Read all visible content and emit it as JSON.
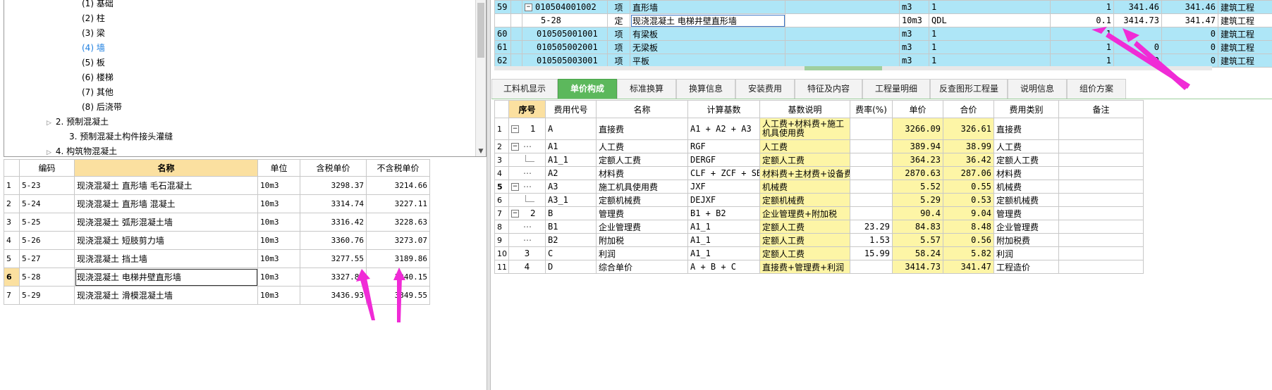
{
  "tree": {
    "items": [
      {
        "label": "(1) 基础",
        "indent": 3
      },
      {
        "label": "(2) 柱",
        "indent": 3
      },
      {
        "label": "(3) 梁",
        "indent": 3
      },
      {
        "label": "(4) 墙",
        "indent": 3,
        "selected": true
      },
      {
        "label": "(5) 板",
        "indent": 3
      },
      {
        "label": "(6) 楼梯",
        "indent": 3
      },
      {
        "label": "(7) 其他",
        "indent": 3
      },
      {
        "label": "(8) 后浇带",
        "indent": 3
      },
      {
        "label": "2. 预制混凝土",
        "indent": 1,
        "arrow": "▷"
      },
      {
        "label": "3. 预制混凝土构件接头灌缝",
        "indent": 2
      },
      {
        "label": "4. 构筑物混凝土",
        "indent": 1,
        "arrow": "▷"
      }
    ]
  },
  "quota_table": {
    "headers": [
      "",
      "编码",
      "名称",
      "单位",
      "含税单价",
      "不含税单价"
    ],
    "rows": [
      {
        "idx": "1",
        "code": "5-23",
        "name": "现浇混凝土 直形墙 毛石混凝土",
        "unit": "10m3",
        "tax_price": "3298.37",
        "notax_price": "3214.66"
      },
      {
        "idx": "2",
        "code": "5-24",
        "name": "现浇混凝土 直形墙 混凝土",
        "unit": "10m3",
        "tax_price": "3314.74",
        "notax_price": "3227.11"
      },
      {
        "idx": "3",
        "code": "5-25",
        "name": "现浇混凝土 弧形混凝土墙",
        "unit": "10m3",
        "tax_price": "3316.42",
        "notax_price": "3228.63"
      },
      {
        "idx": "4",
        "code": "5-26",
        "name": "现浇混凝土 短肢剪力墙",
        "unit": "10m3",
        "tax_price": "3360.76",
        "notax_price": "3273.07"
      },
      {
        "idx": "5",
        "code": "5-27",
        "name": "现浇混凝土 挡土墙",
        "unit": "10m3",
        "tax_price": "3277.55",
        "notax_price": "3189.86"
      },
      {
        "idx": "6",
        "code": "5-28",
        "name": "现浇混凝土 电梯井壁直形墙",
        "unit": "10m3",
        "tax_price": "3327.84",
        "notax_price": "3240.15",
        "current": true
      },
      {
        "idx": "7",
        "code": "5-29",
        "name": "现浇混凝土 滑模混凝土墙",
        "unit": "10m3",
        "tax_price": "3436.93",
        "notax_price": "3349.55"
      }
    ]
  },
  "boq_table": {
    "rows": [
      {
        "seq": "59",
        "code": "010504001002",
        "type": "项",
        "name": "直形墙",
        "unit": "m3",
        "expr": "1",
        "qty": "1",
        "price": "341.46",
        "total": "341.46",
        "category": "建筑工程",
        "box": "−"
      },
      {
        "seq": "",
        "code": "5-28",
        "type": "定",
        "name": "现浇混凝土 电梯井壁直形墙",
        "unit": "10m3",
        "expr": "QDL",
        "qty": "0.1",
        "price": "3414.73",
        "total": "341.47",
        "category": "建筑工程",
        "sub": true
      },
      {
        "seq": "60",
        "code": "010505001001",
        "type": "项",
        "name": "有梁板",
        "unit": "m3",
        "expr": "1",
        "qty": "1",
        "price": "",
        "total": "0",
        "category": "建筑工程"
      },
      {
        "seq": "61",
        "code": "010505002001",
        "type": "项",
        "name": "无梁板",
        "unit": "m3",
        "expr": "1",
        "qty": "1",
        "price": "0",
        "total": "0",
        "category": "建筑工程"
      },
      {
        "seq": "62",
        "code": "010505003001",
        "type": "项",
        "name": "平板",
        "unit": "m3",
        "expr": "1",
        "qty": "1",
        "price": "0",
        "total": "0",
        "category": "建筑工程"
      }
    ]
  },
  "tabs": [
    {
      "label": "工料机显示",
      "active": false
    },
    {
      "label": "单价构成",
      "active": true
    },
    {
      "label": "标准换算",
      "active": false
    },
    {
      "label": "换算信息",
      "active": false
    },
    {
      "label": "安装费用",
      "active": false
    },
    {
      "label": "特征及内容",
      "active": false
    },
    {
      "label": "工程量明细",
      "active": false
    },
    {
      "label": "反查图形工程量",
      "active": false
    },
    {
      "label": "说明信息",
      "active": false
    },
    {
      "label": "组价方案",
      "active": false
    }
  ],
  "price_table": {
    "headers": [
      "序号",
      "费用代号",
      "名称",
      "计算基数",
      "基数说明",
      "费率(%)",
      "单价",
      "合价",
      "费用类别",
      "备注"
    ],
    "rows": [
      {
        "idx": "1",
        "ord": "1",
        "tree": "minus",
        "code": "A",
        "name": "直接费",
        "base": "A1 + A2 + A3",
        "desc": "人工费+材料费+施工机具使用费",
        "rate": "",
        "unit_price": "3266.09",
        "total": "326.61",
        "category": "直接费",
        "tall": true
      },
      {
        "idx": "2",
        "ord": "",
        "tree": "minus-dots",
        "code": "A1",
        "name": "人工费",
        "base": "RGF",
        "desc": "人工费",
        "rate": "",
        "unit_price": "389.94",
        "total": "38.99",
        "category": "人工费"
      },
      {
        "idx": "3",
        "ord": "",
        "tree": "line",
        "code": "A1_1",
        "name": "定额人工费",
        "base": "DERGF",
        "desc": "定额人工费",
        "rate": "",
        "unit_price": "364.23",
        "total": "36.42",
        "category": "定额人工费"
      },
      {
        "idx": "4",
        "ord": "",
        "tree": "dots",
        "code": "A2",
        "name": "材料费",
        "base": "CLF + ZCF + SBF",
        "desc": "材料费+主材费+设备费",
        "rate": "",
        "unit_price": "2870.63",
        "total": "287.06",
        "category": "材料费"
      },
      {
        "idx": "5",
        "ord": "",
        "tree": "minus-dots",
        "code": "A3",
        "name": "施工机具使用费",
        "base": "JXF",
        "desc": "机械费",
        "rate": "",
        "unit_price": "5.52",
        "total": "0.55",
        "category": "机械费",
        "current": true
      },
      {
        "idx": "6",
        "ord": "",
        "tree": "line",
        "code": "A3_1",
        "name": "定额机械费",
        "base": "DEJXF",
        "desc": "定额机械费",
        "rate": "",
        "unit_price": "5.29",
        "total": "0.53",
        "category": "定额机械费"
      },
      {
        "idx": "7",
        "ord": "2",
        "tree": "minus",
        "code": "B",
        "name": "管理费",
        "base": "B1 + B2",
        "desc": "企业管理费+附加税",
        "rate": "",
        "unit_price": "90.4",
        "total": "9.04",
        "category": "管理费"
      },
      {
        "idx": "8",
        "ord": "",
        "tree": "dots",
        "code": "B1",
        "name": "企业管理费",
        "base": "A1_1",
        "desc": "定额人工费",
        "rate": "23.29",
        "unit_price": "84.83",
        "total": "8.48",
        "category": "企业管理费"
      },
      {
        "idx": "9",
        "ord": "",
        "tree": "dots",
        "code": "B2",
        "name": "附加税",
        "base": "A1_1",
        "desc": "定额人工费",
        "rate": "1.53",
        "unit_price": "5.57",
        "total": "0.56",
        "category": "附加税费"
      },
      {
        "idx": "10",
        "ord": "3",
        "tree": "",
        "code": "C",
        "name": "利润",
        "base": "A1_1",
        "desc": "定额人工费",
        "rate": "15.99",
        "unit_price": "58.24",
        "total": "5.82",
        "category": "利润"
      },
      {
        "idx": "11",
        "ord": "4",
        "tree": "",
        "code": "D",
        "name": "综合单价",
        "base": "A + B + C",
        "desc": "直接费+管理费+利润",
        "rate": "",
        "unit_price": "3414.73",
        "total": "341.47",
        "category": "工程造价"
      }
    ]
  },
  "colors": {
    "boq_row": "#aee6f7",
    "header_highlight": "#fbe0a0",
    "yellow_cell": "#fdf5a6",
    "active_tab": "#5cb85c",
    "annotation_arrow": "#f02bd6",
    "tree_selected": "#1e7fe0"
  }
}
